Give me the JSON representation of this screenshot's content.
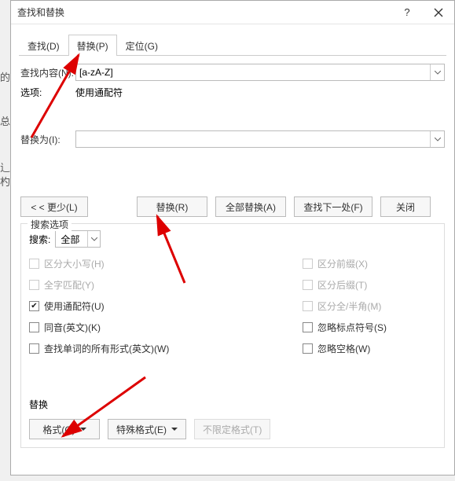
{
  "title": "查找和替换",
  "tabs": {
    "find": "查找(D)",
    "replace": "替换(P)",
    "goto": "定位(G)"
  },
  "find_label": "查找内容(N):",
  "find_value": "[a-zA-Z]",
  "options_label": "选项:",
  "options_value": "使用通配符",
  "replace_label": "替换为(I):",
  "replace_value": "",
  "buttons": {
    "less": "< < 更少(L)",
    "replace": "替换(R)",
    "replace_all": "全部替换(A)",
    "find_next": "查找下一处(F)",
    "close": "关闭"
  },
  "fieldset_legend": "搜索选项",
  "search_label": "搜索:",
  "search_value": "全部",
  "checks": {
    "match_case": "区分大小写(H)",
    "whole_word": "全字匹配(Y)",
    "wildcards": "使用通配符(U)",
    "sounds_like": "同音(英文)(K)",
    "all_forms": "查找单词的所有形式(英文)(W)",
    "prefix": "区分前缀(X)",
    "suffix": "区分后缀(T)",
    "width": "区分全/半角(M)",
    "punct": "忽略标点符号(S)",
    "space": "忽略空格(W)"
  },
  "bottom_label": "替换",
  "bottom_buttons": {
    "format": "格式(O)",
    "special": "特殊格式(E)",
    "no_format": "不限定格式(T)"
  },
  "edges": {
    "a": "的",
    "b": "总",
    "c": "辶",
    "d": "杓"
  }
}
